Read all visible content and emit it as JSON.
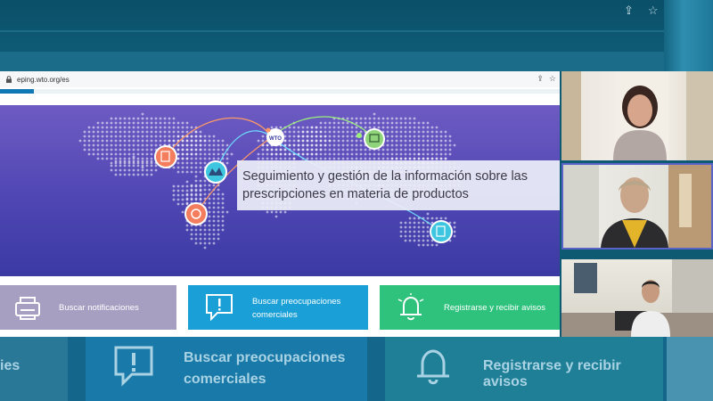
{
  "browser": {
    "url": "eping.wto.org/es",
    "page_load_progress": 0.06
  },
  "hero": {
    "caption": "Seguimiento y gestión de la información sobre las prescripciones en materia de productos",
    "hub_label": "WTO"
  },
  "tiles": [
    {
      "label": "Buscar notificaciones",
      "icon": "printer-icon",
      "color": "#a79fc2"
    },
    {
      "label": "Buscar preocupaciones comerciales",
      "icon": "speech-exclamation-icon",
      "color": "#1aa0d6"
    },
    {
      "label": "Registrarse y recibir avisos",
      "icon": "bell-icon",
      "color": "#2ec27d"
    }
  ],
  "background_zoom": {
    "left_label": "ies",
    "center_label": "Buscar preocupaciones comerciales",
    "right_label": "Registrarse y recibir avisos"
  },
  "participants": [
    {
      "id": "participant-1",
      "active_speaker": false
    },
    {
      "id": "participant-2",
      "active_speaker": true
    },
    {
      "id": "participant-3",
      "active_speaker": false
    }
  ],
  "colors": {
    "hero_top": "#6e5bc3",
    "hero_bottom": "#3b3aa3",
    "active_border": "#5a63c8"
  }
}
